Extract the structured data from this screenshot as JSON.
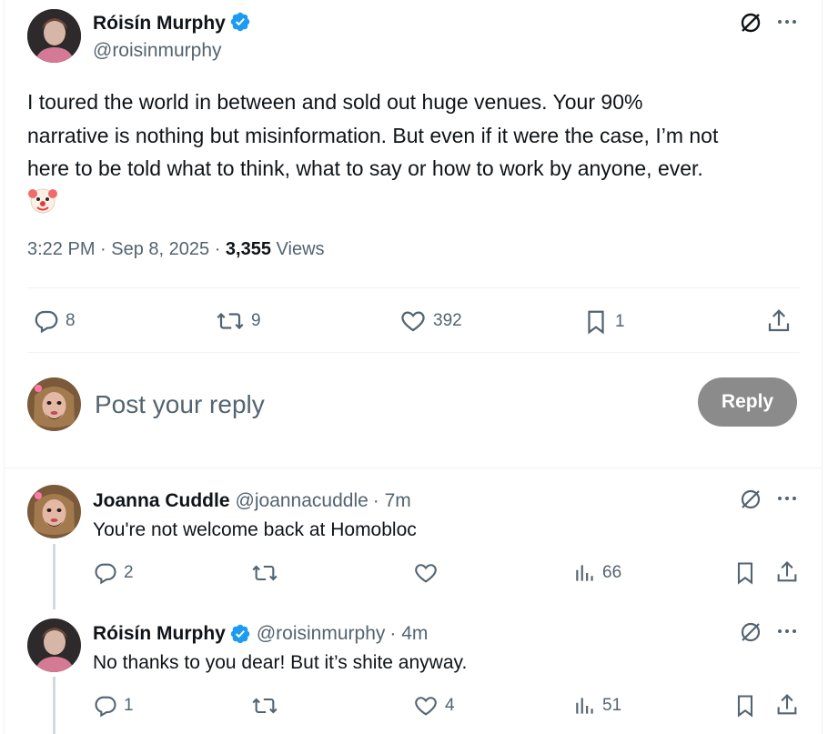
{
  "main_tweet": {
    "author_name": "Róisín Murphy",
    "author_handle": "@roisinmurphy",
    "text_lines": [
      "I toured the world in between and sold out huge venues. Your 90%",
      "narrative is nothing but misinformation. But even if it were the case, I’m not",
      "here to be told what to think, what to say or how to work by anyone, ever."
    ],
    "emoji": "🤡",
    "time": "3:22 PM",
    "date": "Sep 8, 2025",
    "views_count": "3,355",
    "views_label": "Views",
    "replies": "8",
    "reposts": "9",
    "likes": "392",
    "bookmarks": "1"
  },
  "reply_box": {
    "placeholder": "Post your reply",
    "button_label": "Reply"
  },
  "replies": [
    {
      "author_name": "Joanna Cuddle",
      "author_handle": "@joannacuddle",
      "time": "· 7m",
      "text": "You're not welcome back at Homobloc",
      "replies": "2",
      "reposts": "",
      "likes": "",
      "views": "66"
    },
    {
      "author_name": "Róisín Murphy",
      "author_handle": "@roisinmurphy",
      "time": "· 4m",
      "text": "No thanks to you dear! But it’s shite anyway.",
      "replies": "1",
      "reposts": "",
      "likes": "4",
      "views": "51"
    }
  ],
  "colors": {
    "verified": "#1d9bf0",
    "reply_button_bg": "#8b8b8b",
    "muted_text": "#536471"
  }
}
